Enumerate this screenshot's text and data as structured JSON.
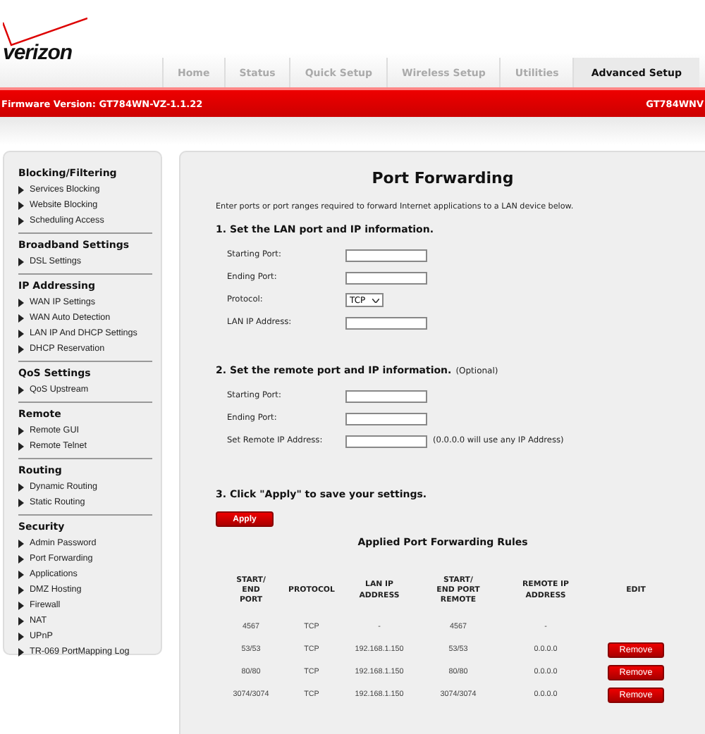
{
  "logo": {
    "text": "verizon"
  },
  "tabs": [
    {
      "label": "Home",
      "selected": false
    },
    {
      "label": "Status",
      "selected": false
    },
    {
      "label": "Quick Setup",
      "selected": false
    },
    {
      "label": "Wireless Setup",
      "selected": false
    },
    {
      "label": "Utilities",
      "selected": false
    },
    {
      "label": "Advanced Setup",
      "selected": true
    }
  ],
  "firmware_bar": {
    "version": "Firmware Version: GT784WN-VZ-1.1.22",
    "model": "GT784WNV"
  },
  "sidebar": {
    "groups": [
      {
        "title": "Blocking/Filtering",
        "items": [
          "Services Blocking",
          "Website Blocking",
          "Scheduling Access"
        ]
      },
      {
        "title": "Broadband Settings",
        "items": [
          "DSL Settings"
        ]
      },
      {
        "title": "IP Addressing",
        "items": [
          "WAN IP Settings",
          "WAN Auto Detection",
          "LAN IP And DHCP Settings",
          "DHCP Reservation"
        ]
      },
      {
        "title": "QoS Settings",
        "items": [
          "QoS Upstream"
        ]
      },
      {
        "title": "Remote",
        "items": [
          "Remote GUI",
          "Remote Telnet"
        ]
      },
      {
        "title": "Routing",
        "items": [
          "Dynamic Routing",
          "Static Routing"
        ]
      },
      {
        "title": "Security",
        "items": [
          "Admin Password",
          "Port Forwarding",
          "Applications",
          "DMZ Hosting",
          "Firewall",
          "NAT",
          "UPnP",
          "TR-069 PortMapping Log"
        ]
      }
    ]
  },
  "main": {
    "title": "Port Forwarding",
    "intro": "Enter ports or port ranges required to forward Internet applications to a LAN device below.",
    "sections": [
      {
        "heading": "1. Set the LAN port and IP information.",
        "fields": [
          {
            "kind": "text",
            "label": "Starting Port:"
          },
          {
            "kind": "text",
            "label": "Ending Port:"
          },
          {
            "kind": "select",
            "label": "Protocol:",
            "value": "TCP"
          },
          {
            "kind": "text",
            "label": "LAN IP Address:"
          }
        ]
      },
      {
        "heading": "2. Set the remote port and IP information.",
        "note": "(Optional)",
        "fields": [
          {
            "kind": "text",
            "label": "Starting Port:"
          },
          {
            "kind": "text",
            "label": "Ending Port:"
          },
          {
            "kind": "text",
            "label": "Set Remote IP Address:",
            "hint": "(0.0.0.0 will use any IP Address)"
          }
        ]
      }
    ],
    "apply_step": "3. Click \"Apply\" to save your settings.",
    "apply_button": "Apply",
    "rules": {
      "title": "Applied Port Forwarding Rules",
      "columns": [
        "START/\nEND\nPORT",
        "PROTOCOL",
        "LAN IP\nADDRESS",
        "START/\nEND PORT\nREMOTE",
        "REMOTE IP\nADDRESS",
        "EDIT"
      ],
      "rows": [
        {
          "cells": [
            "4567",
            "TCP",
            "-",
            "4567",
            "-"
          ]
        },
        {
          "cells": [
            "53/53",
            "TCP",
            "192.168.1.150",
            "53/53",
            "0.0.0.0"
          ],
          "action": "Remove"
        },
        {
          "cells": [
            "80/80",
            "TCP",
            "192.168.1.150",
            "80/80",
            "0.0.0.0"
          ],
          "action": "Remove"
        },
        {
          "cells": [
            "3074/3074",
            "TCP",
            "192.168.1.150",
            "3074/3074",
            "0.0.0.0"
          ],
          "action": "Remove"
        }
      ]
    }
  }
}
